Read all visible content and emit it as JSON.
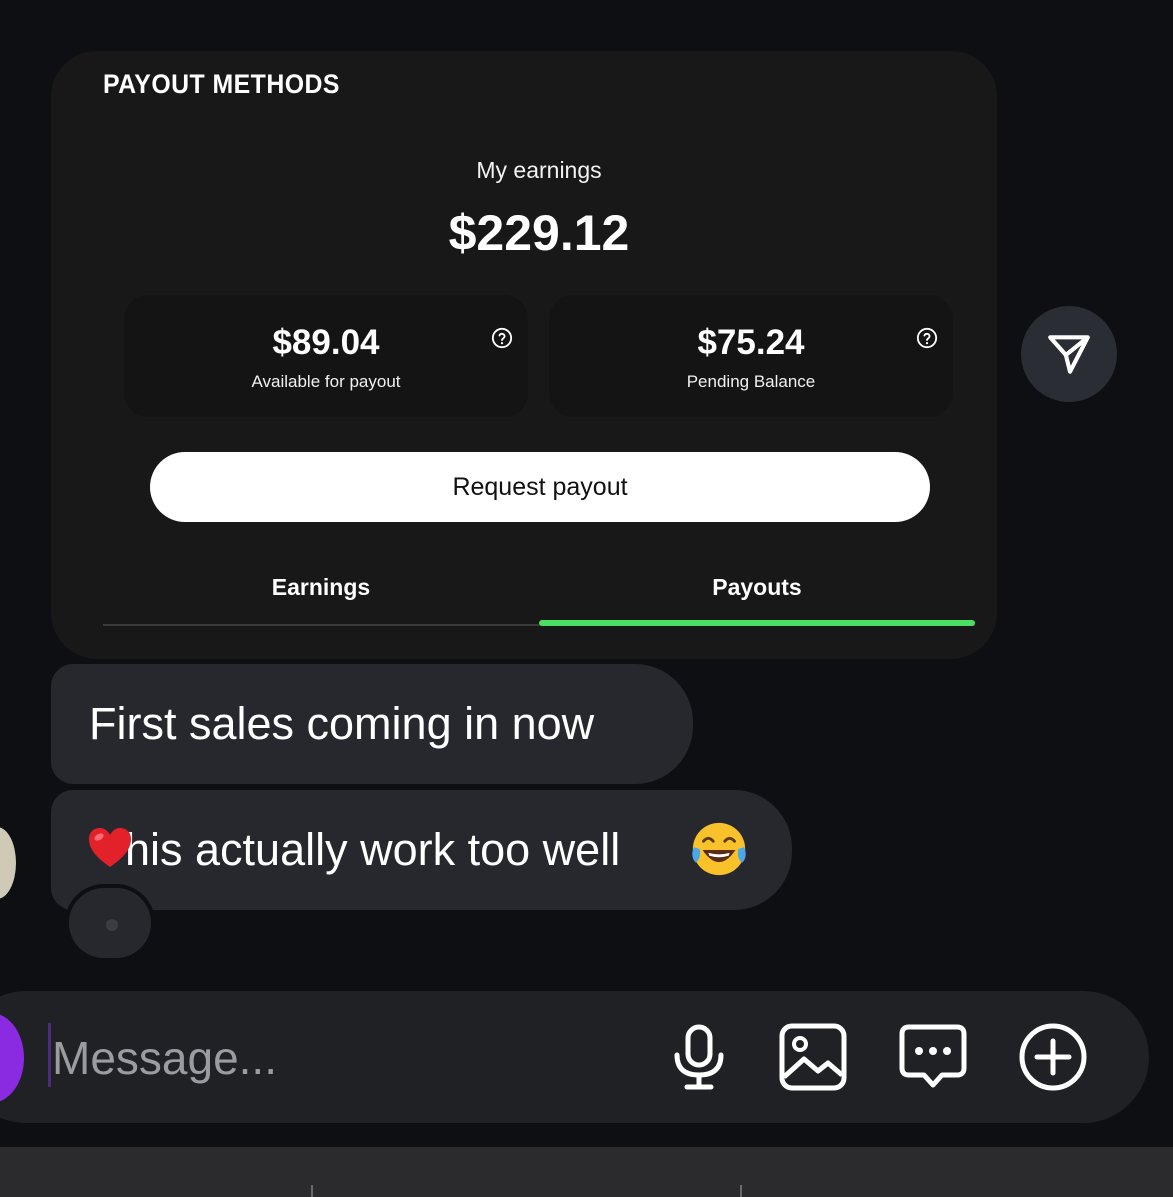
{
  "card": {
    "heading": "PAYOUT METHODS",
    "earnings_label": "My earnings",
    "earnings_total": "$229.12",
    "available": {
      "amount": "$89.04",
      "label": "Available for payout"
    },
    "pending": {
      "amount": "$75.24",
      "label": "Pending Balance"
    },
    "request_button": "Request payout",
    "tabs": [
      {
        "label": "Earnings",
        "active": false
      },
      {
        "label": "Payouts",
        "active": true
      }
    ],
    "accent_color": "#4ade63"
  },
  "messages": [
    {
      "text": "First sales coming in now"
    },
    {
      "text": "his actually work too well",
      "prefix_icon": "red-heart-emoji",
      "suffix_icon": "tears-of-joy-emoji"
    }
  ],
  "composer": {
    "placeholder": "Message...",
    "icons": [
      "microphone-icon",
      "image-icon",
      "chat-bubble-icon",
      "add-circle-icon"
    ]
  },
  "share_icon": "send-icon"
}
